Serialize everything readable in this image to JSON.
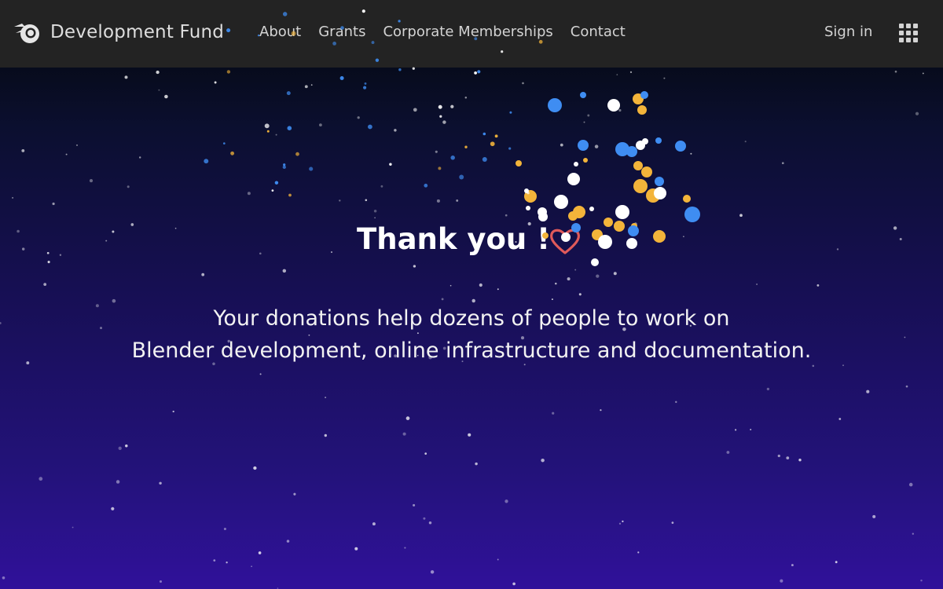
{
  "navbar": {
    "brand": "Development Fund",
    "links": [
      "About",
      "Grants",
      "Corporate Memberships",
      "Contact"
    ],
    "sign_in": "Sign in"
  },
  "hero": {
    "title": "Thank you !",
    "line1": "Your donations help dozens of people to work on",
    "line2": "Blender development, online infrastructure and documentation."
  },
  "icons": {
    "brand": "blender-logo-icon",
    "heart": "heart-icon",
    "apps": "apps-grid-icon"
  },
  "colors": {
    "navbar": "#232323",
    "confetti_blue": "#3f8df2",
    "confetti_yellow": "#f3b43a",
    "confetti_white": "#ffffff",
    "heart": "#e05a5a"
  }
}
